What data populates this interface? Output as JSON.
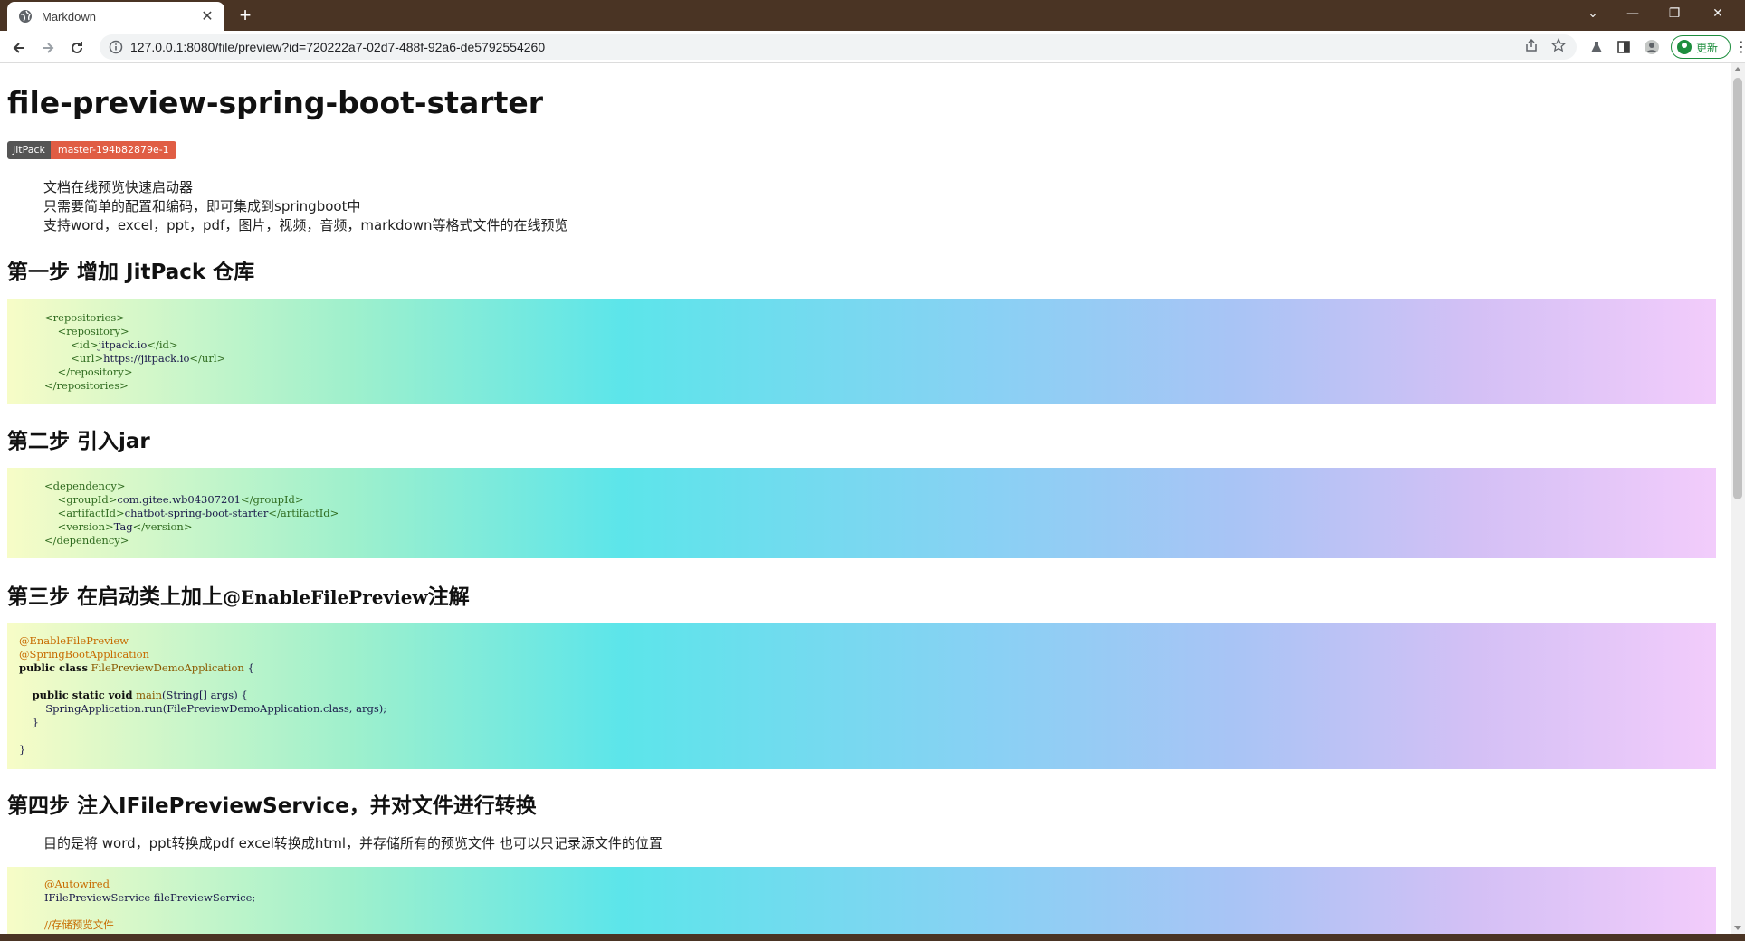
{
  "browser": {
    "tab_title": "Markdown",
    "tab_close": "✕",
    "new_tab": "+",
    "url": "127.0.0.1:8080/file/preview?id=720222a7-02d7-488f-92a6-de5792554260",
    "update_label": "更新",
    "window_controls": {
      "minimize": "—",
      "restore": "❐",
      "close": "✕",
      "tablist": "⌄"
    }
  },
  "doc": {
    "title": "file-preview-spring-boot-starter",
    "badge": {
      "left": "JitPack",
      "right": "master-194b82879e-1"
    },
    "intro": [
      "文档在线预览快速启动器",
      "只需要简单的配置和编码，即可集成到springboot中",
      "支持word，excel，ppt，pdf，图片，视频，音频，markdown等格式文件的在线预览"
    ],
    "step1": {
      "heading": "第一步 增加 JitPack 仓库",
      "code": {
        "repositories_open": "<repositories>",
        "repository_open": "<repository>",
        "id_open": "<id>",
        "id_value": "jitpack.io",
        "id_close": "</id>",
        "url_open": "<url>",
        "url_value": "https://jitpack.io",
        "url_close": "</url>",
        "repository_close": "</repository>",
        "repositories_close": "</repositories>"
      }
    },
    "step2": {
      "heading": "第二步 引入jar",
      "code": {
        "dependency_open": "<dependency>",
        "groupId_open": "<groupId>",
        "groupId_value": "com.gitee.wb04307201",
        "groupId_close": "</groupId>",
        "artifactId_open": "<artifactId>",
        "artifactId_value": "chatbot-spring-boot-starter",
        "artifactId_close": "</artifactId>",
        "version_open": "<version>",
        "version_value": "Tag",
        "version_close": "</version>",
        "dependency_close": "</dependency>"
      }
    },
    "step3": {
      "heading_prefix": "第三步 在启动类上加上",
      "heading_code": "@EnableFilePreview",
      "heading_suffix": "注解",
      "code": {
        "ann1": "@EnableFilePreview",
        "ann2": "@SpringBootApplication",
        "class_kw": "public class",
        "class_name": "FilePreviewDemoApplication",
        "brace_open": " {",
        "method_kw": "public static void",
        "method_name": "main",
        "method_args": "(String[] args) {",
        "call": "SpringApplication.run(FilePreviewDemoApplication.class, args);",
        "inner_close": "}",
        "outer_close": "}"
      }
    },
    "step4": {
      "heading": "第四步 注入IFilePreviewService，并对文件进行转换",
      "desc": "目的是将 word，ppt转换成pdf excel转换成html，并存储所有的预览文件 也可以只记录源文件的位置",
      "code": {
        "ann": "@Autowired",
        "field": "IFilePreviewService filePreviewService;",
        "comment": "//存储预览文件"
      }
    }
  }
}
